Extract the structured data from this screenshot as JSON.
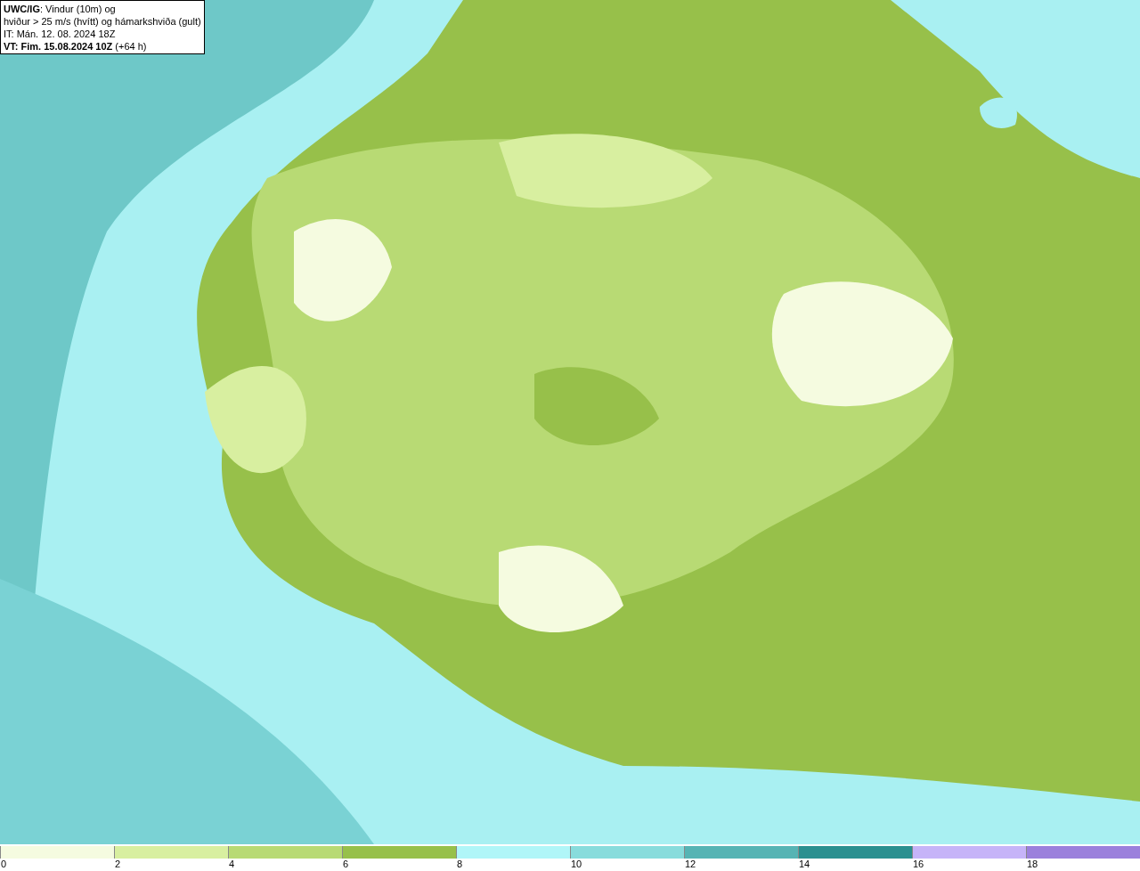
{
  "title_box": {
    "lines": [
      "**UWC/IG**: Vindur (10m) og",
      "hviður > 25 m/s (hvítt) og hámarkshviða (gult)",
      "IT: Mán. 12. 08. 2024 18Z",
      "**VT: Fim. 15.08.2024 10Z** (+64 h)"
    ]
  },
  "legend": {
    "bins": [
      {
        "color": "#f5fbe0"
      },
      {
        "color": "#d8efa0"
      },
      {
        "color": "#b8da74"
      },
      {
        "color": "#97c04a"
      },
      {
        "color": "#b0f6f8"
      },
      {
        "color": "#88dcdc"
      },
      {
        "color": "#56b4b4"
      },
      {
        "color": "#2a9090"
      },
      {
        "color": "#c6b4f8"
      },
      {
        "color": "#9b80dc"
      }
    ],
    "ticks": [
      "0",
      "2",
      "4",
      "6",
      "8",
      "10",
      "12",
      "14",
      "16",
      "18"
    ]
  }
}
